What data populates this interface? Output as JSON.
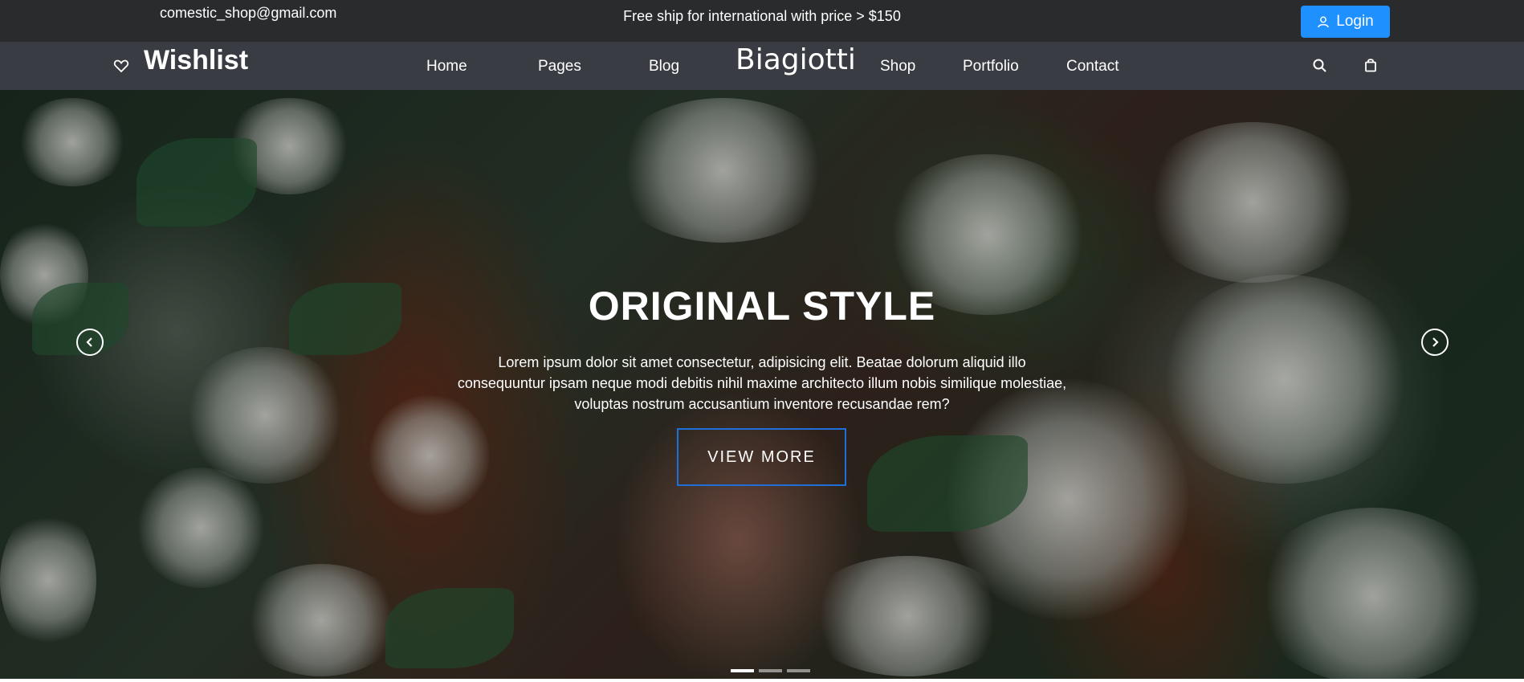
{
  "topbar": {
    "email": "comestic_shop@gmail.com",
    "promo": "Free ship for international with price > $150",
    "login_label": "Login"
  },
  "navbar": {
    "brand": "Wishlist",
    "logo": "Biagiotti",
    "links": [
      "Home",
      "Pages",
      "Blog",
      "Shop",
      "Portfolio",
      "Contact"
    ],
    "icons": [
      "heart-icon",
      "search-icon",
      "shopping-bag-icon",
      "user-icon"
    ]
  },
  "hero": {
    "title": "ORIGINAL STYLE",
    "text": "Lorem ipsum dolor sit amet consectetur, adipisicing elit. Beatae dolorum aliquid illo consequuntur ipsam neque modi debitis nihil maxime architecto illum nobis similique molestiae, voluptas nostrum accusantium inventore recusandae rem?",
    "button_label": "VIEW MORE",
    "slides_count": 3,
    "active_slide": 1
  },
  "colors": {
    "topbar_bg": "#2a2b2d",
    "navbar_bg": "#393d43",
    "accent": "#1e90ff",
    "button_border": "#1e6fd9"
  }
}
